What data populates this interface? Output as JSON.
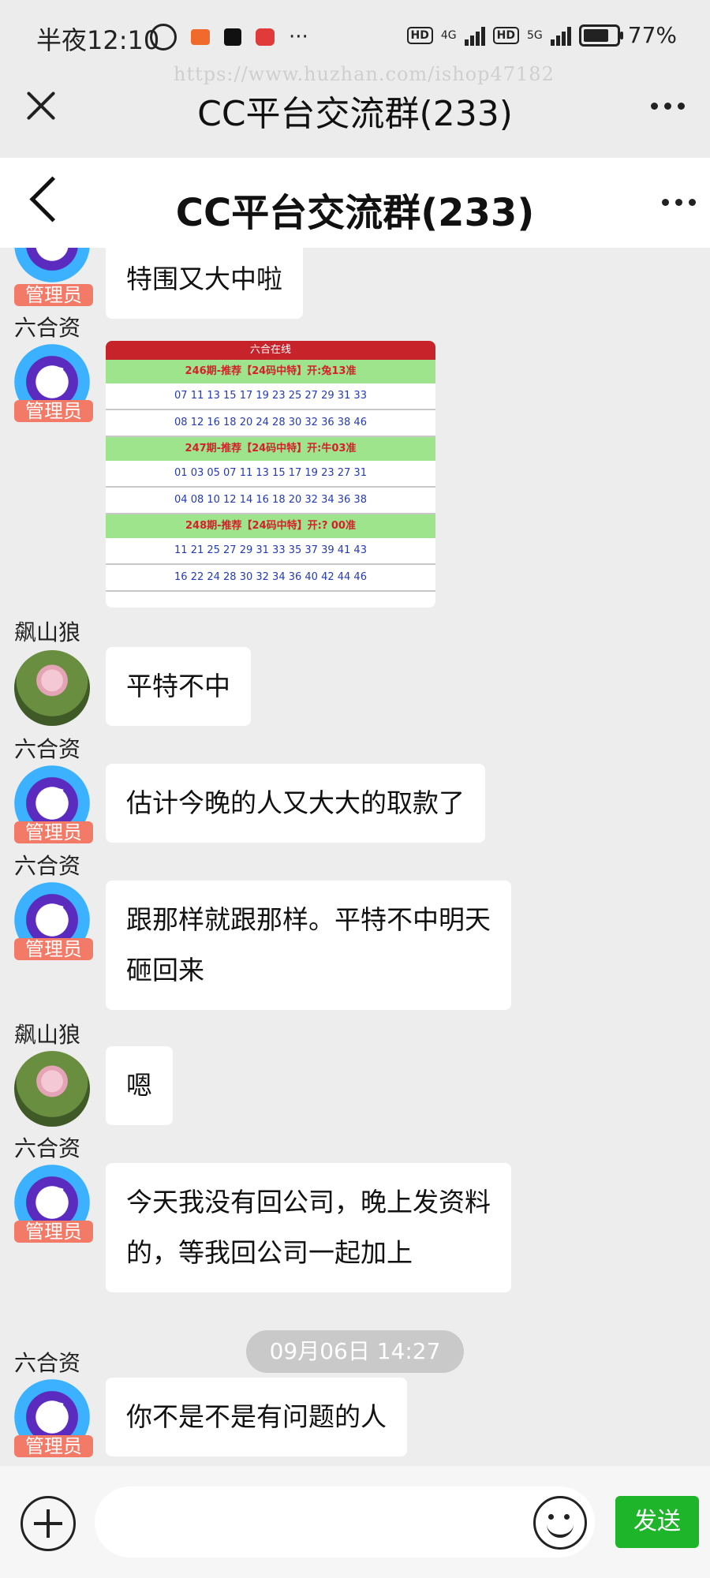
{
  "status": {
    "time": "半夜12:10",
    "net1": "4G",
    "net2": "5G",
    "hd": "HD",
    "battery": "77%",
    "more": "···",
    "battery_level_pct": 77
  },
  "watermark": "https://www.huzhan.com/ishop47182",
  "outer_header": {
    "title": "CC平台交流群(233)"
  },
  "inner_header": {
    "title": "CC平台交流群(233)"
  },
  "lottery_image": {
    "top": "六合在线",
    "rows": [
      {
        "type": "title",
        "text": "246期-推荐【24码中特】开:兔13准"
      },
      {
        "type": "nums",
        "text": "07 11 13 15 17 19 23 25 27 29 31 33"
      },
      {
        "type": "nums",
        "text": "08 12 16 18 20 24 28 30 32 36 38 46"
      },
      {
        "type": "title",
        "text": "247期-推荐【24码中特】开:牛03准"
      },
      {
        "type": "nums",
        "text": "01 03 05 07 11 13 15 17 19 23 27 31"
      },
      {
        "type": "nums",
        "text": "04 08 10 12 14 16 18 20 32 34 36 38"
      },
      {
        "type": "title",
        "text": "248期-推荐【24码中特】开:? 00准"
      },
      {
        "type": "nums",
        "text": "11 21 25 27 29 31 33 35 37 39 41 43"
      },
      {
        "type": "nums",
        "text": "16 22 24 28 30 32 34 36 40 42 44 46"
      }
    ]
  },
  "messages": {
    "m0": {
      "sender": "",
      "admin": "管理员",
      "text": "特围又大中啦"
    },
    "m1": {
      "sender": "六合资",
      "admin": "管理员"
    },
    "m2": {
      "sender": "飙山狼",
      "text": "平特不中"
    },
    "m3": {
      "sender": "六合资",
      "admin": "管理员",
      "text": "估计今晚的人又大大的取款了"
    },
    "m4": {
      "sender": "六合资",
      "admin": "管理员",
      "text1": "跟那样就跟那样。平特不中明天",
      "text2": "砸回来"
    },
    "m5": {
      "sender": "飙山狼",
      "text": "嗯"
    },
    "m6": {
      "sender": "六合资",
      "admin": "管理员",
      "text1": "今天我没有回公司，晚上发资料",
      "text2": "的，等我回公司一起加上"
    },
    "ts": "09月06日 14:27",
    "m7": {
      "sender": "六合资",
      "admin": "管理员",
      "text": "你不是不是有问题的人"
    }
  },
  "input": {
    "placeholder": "",
    "send": "发送"
  },
  "avatar_glyph": "6"
}
